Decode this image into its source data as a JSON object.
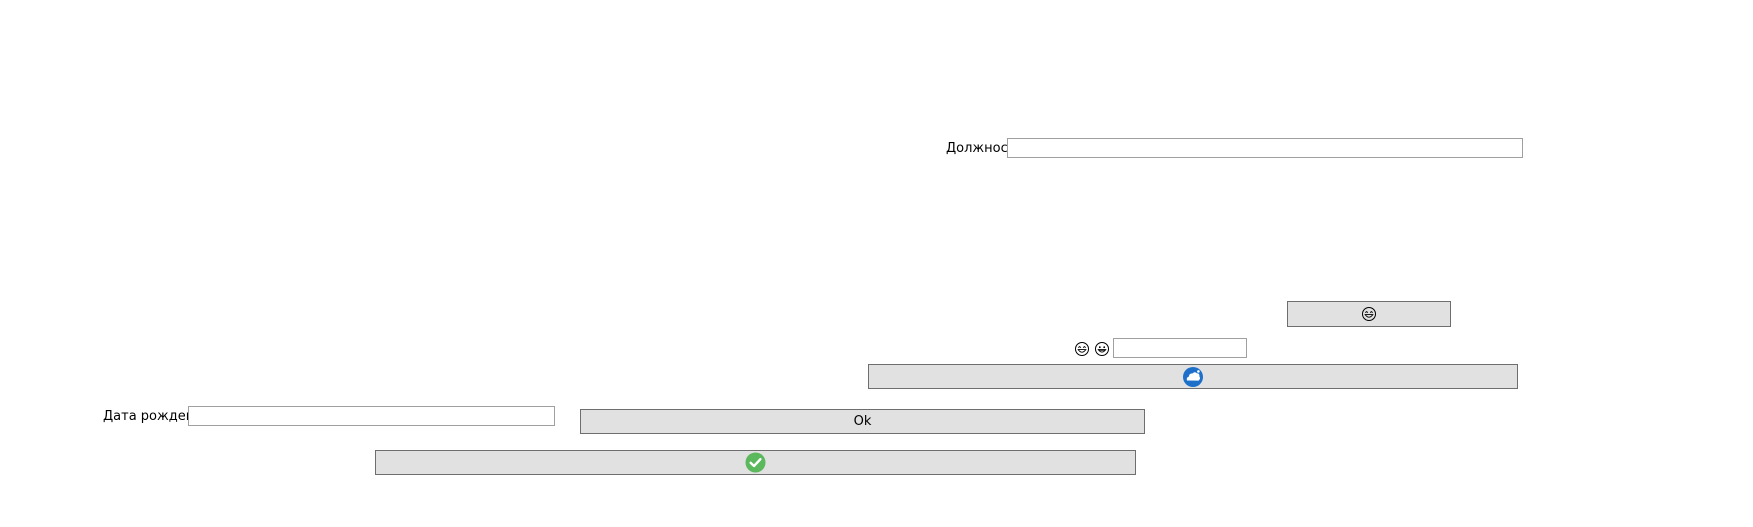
{
  "form": {
    "position_label": "Должность",
    "position_value": "",
    "birthdate_label": "Дата рождения",
    "birthdate_value": "",
    "small_field_value": "",
    "ok_button_label": "Ok"
  },
  "icons": {
    "emoji_button": "laughing-face-icon",
    "emoji_label_1": "laughing-face-icon",
    "emoji_label_2": "grinning-face-icon",
    "cloud_button": "blue-cloud-icon",
    "check_button": "green-check-icon"
  },
  "colors": {
    "button_bg": "#e1e1e1",
    "button_border": "#6e6e6e",
    "field_border": "#a0a0a0",
    "check_green": "#5cb85c",
    "cloud_blue": "#1e6fc9"
  }
}
